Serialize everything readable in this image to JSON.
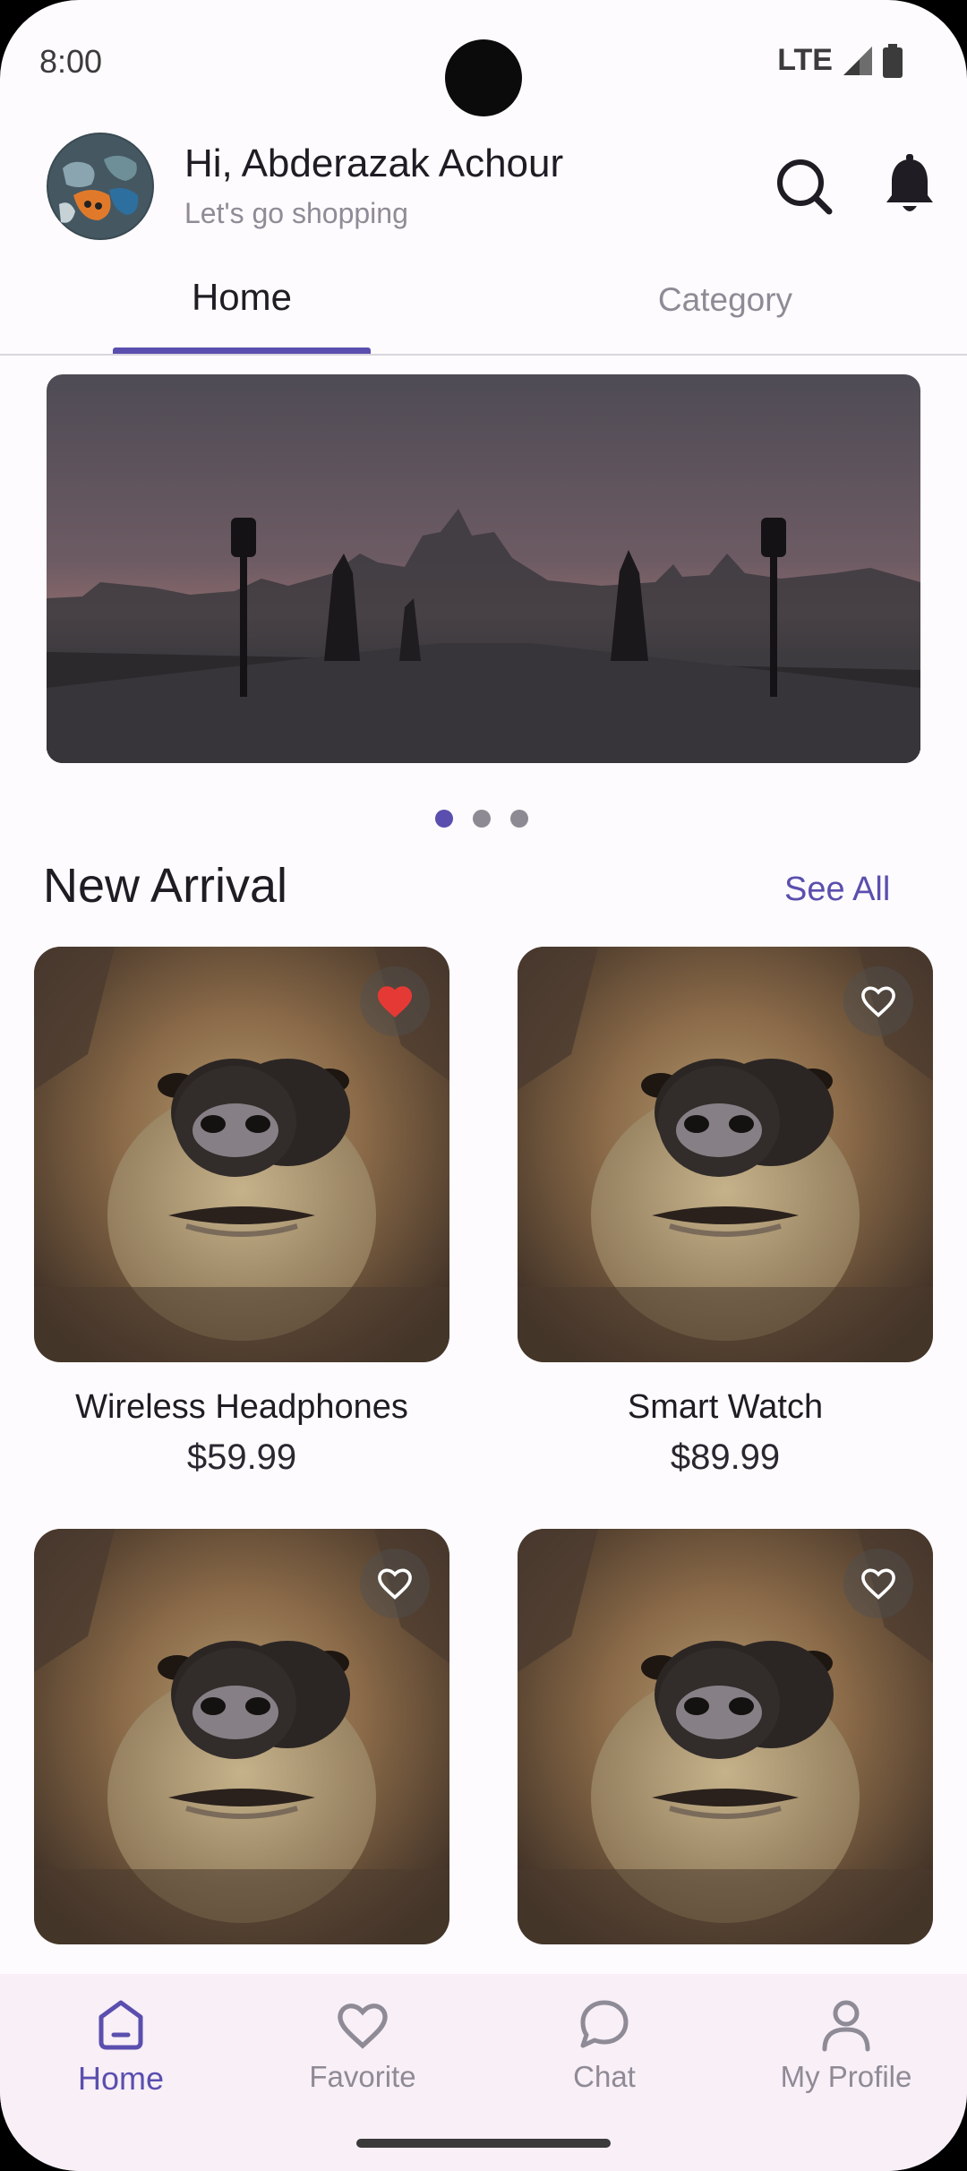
{
  "status_bar": {
    "time": "8:00",
    "network": "LTE"
  },
  "header": {
    "greeting": "Hi, Abderazak Achour",
    "subtitle": "Let's go shopping"
  },
  "tabs": [
    {
      "label": "Home",
      "selected": true
    },
    {
      "label": "Category",
      "selected": false
    }
  ],
  "carousel": {
    "page_count": 3,
    "active_index": 0
  },
  "section": {
    "title": "New Arrival",
    "see_all": "See All"
  },
  "products": [
    {
      "name": "Wireless Headphones",
      "price": "$59.99",
      "favorited": true
    },
    {
      "name": "Smart Watch",
      "price": "$89.99",
      "favorited": false
    },
    {
      "name": "",
      "price": "",
      "favorited": false
    },
    {
      "name": "",
      "price": "",
      "favorited": false
    }
  ],
  "bottom_nav": [
    {
      "label": "Home",
      "icon": "home-icon",
      "active": true
    },
    {
      "label": "Favorite",
      "icon": "heart-icon",
      "active": false
    },
    {
      "label": "Chat",
      "icon": "chat-icon",
      "active": false
    },
    {
      "label": "My Profile",
      "icon": "person-icon",
      "active": false
    }
  ],
  "colors": {
    "accent": "#5a4fae",
    "favorite": "#e53935",
    "background": "#fdfbfd"
  }
}
